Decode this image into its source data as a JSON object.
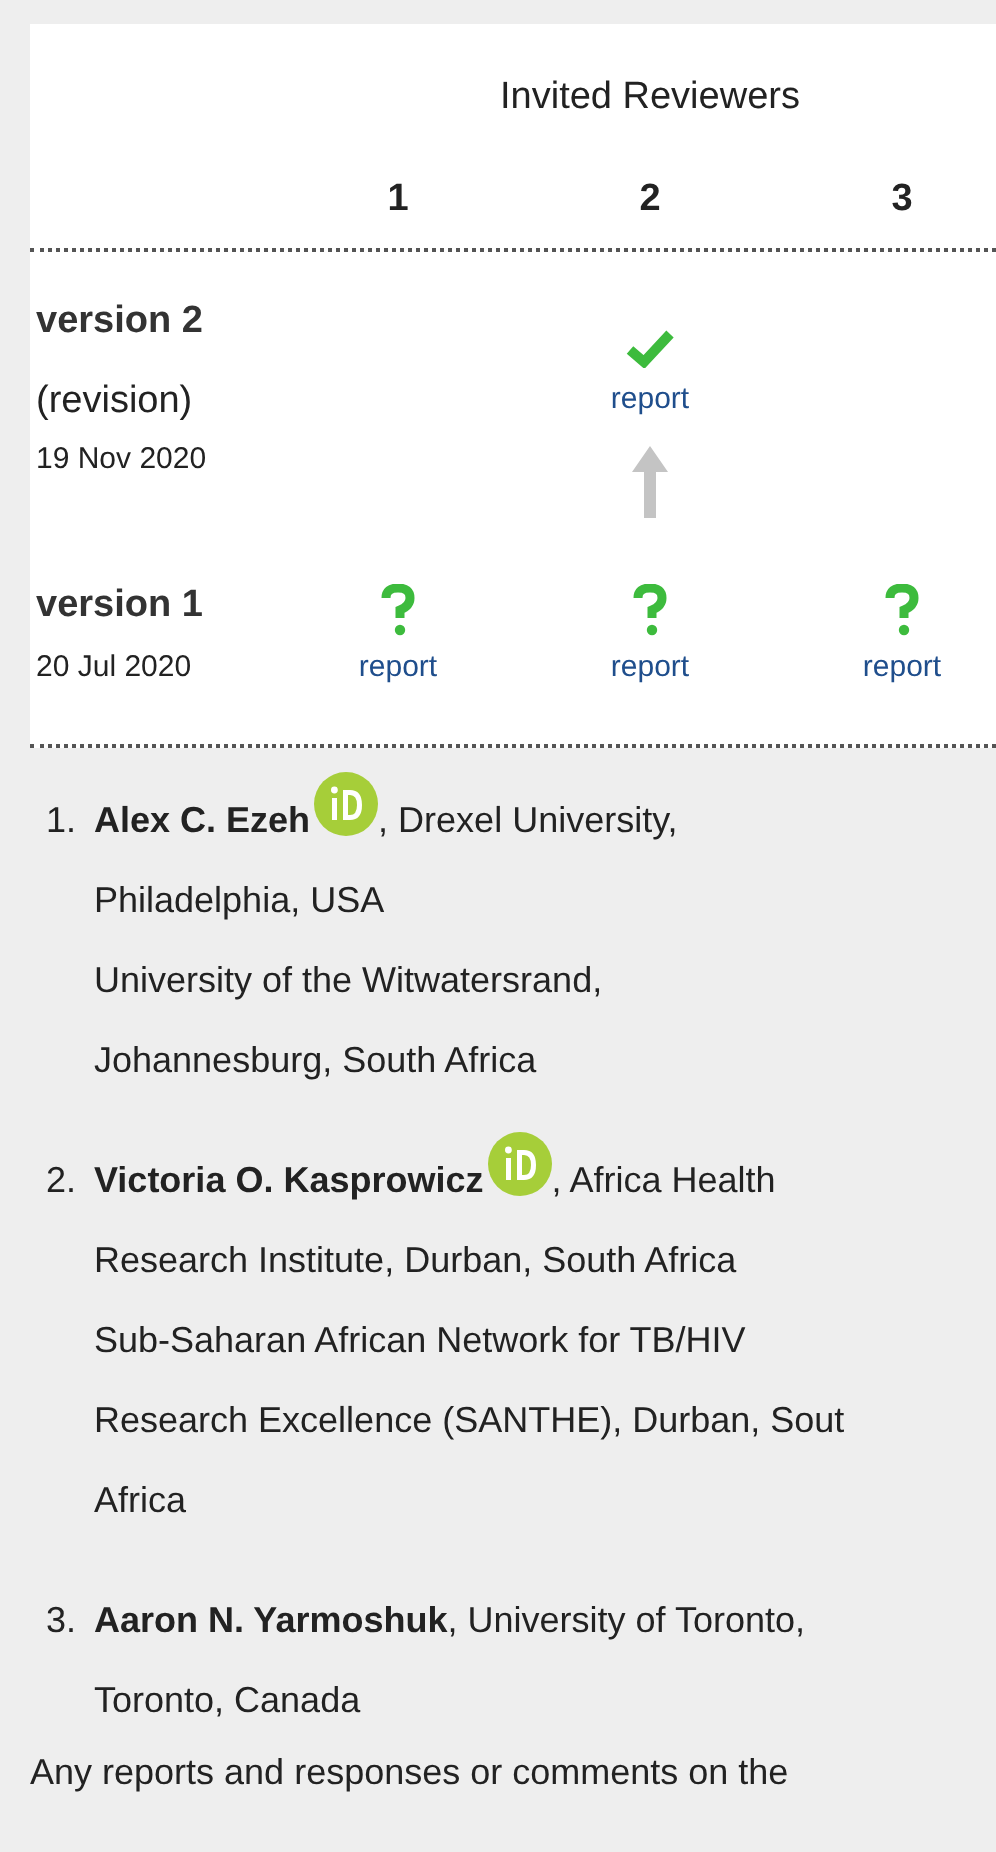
{
  "table": {
    "header": "Invited Reviewers",
    "columns": [
      "1",
      "2",
      "3"
    ],
    "versions": [
      {
        "title": "version 2",
        "note": "(revision)",
        "date": "19 Nov 2020",
        "cells": [
          {
            "kind": "empty"
          },
          {
            "kind": "approved",
            "link": "report",
            "arrow_below": true
          },
          {
            "kind": "empty"
          }
        ]
      },
      {
        "title": "version 1",
        "date": "20 Jul 2020",
        "cells": [
          {
            "kind": "pending",
            "link": "report"
          },
          {
            "kind": "pending",
            "link": "report"
          },
          {
            "kind": "pending",
            "link": "report"
          }
        ]
      }
    ]
  },
  "reviewers": [
    {
      "number": "1.",
      "name": "Alex C. Ezeh",
      "orcid": true,
      "first_line": ", Drexel University,",
      "lines": [
        "Philadelphia, USA",
        "University of the Witwatersrand,",
        "Johannesburg, South Africa"
      ]
    },
    {
      "number": "2.",
      "name": "Victoria O. Kasprowicz",
      "orcid": true,
      "first_line": ", Africa Health",
      "lines": [
        "Research Institute, Durban, South Africa",
        "Sub-Saharan African Network for TB/HIV",
        "Research Excellence (SANTHE), Durban, Sout",
        "Africa"
      ]
    },
    {
      "number": "3.",
      "name": "Aaron N. Yarmoshuk",
      "first_line": ", University of Toronto,",
      "lines": [
        "Toronto, Canada"
      ]
    }
  ],
  "footer": "Any reports and responses or comments on the"
}
